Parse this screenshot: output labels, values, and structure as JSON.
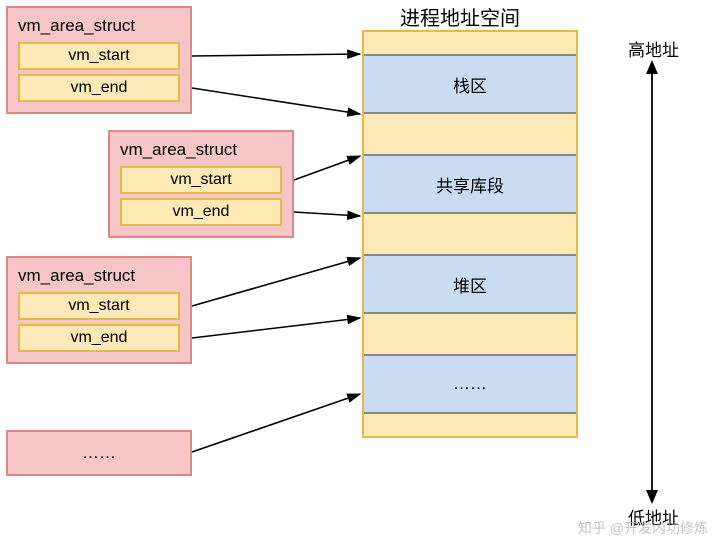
{
  "title": "进程地址空间",
  "high_addr_label": "高地址",
  "low_addr_label": "低地址",
  "vma": {
    "struct_name": "vm_area_struct",
    "start_field": "vm_start",
    "end_field": "vm_end",
    "ellipsis": "……"
  },
  "segments": {
    "stack": "栈区",
    "shared": "共享库段",
    "heap": "堆区",
    "ellipsis": "……"
  },
  "watermark": "知乎 @开发内功修炼"
}
